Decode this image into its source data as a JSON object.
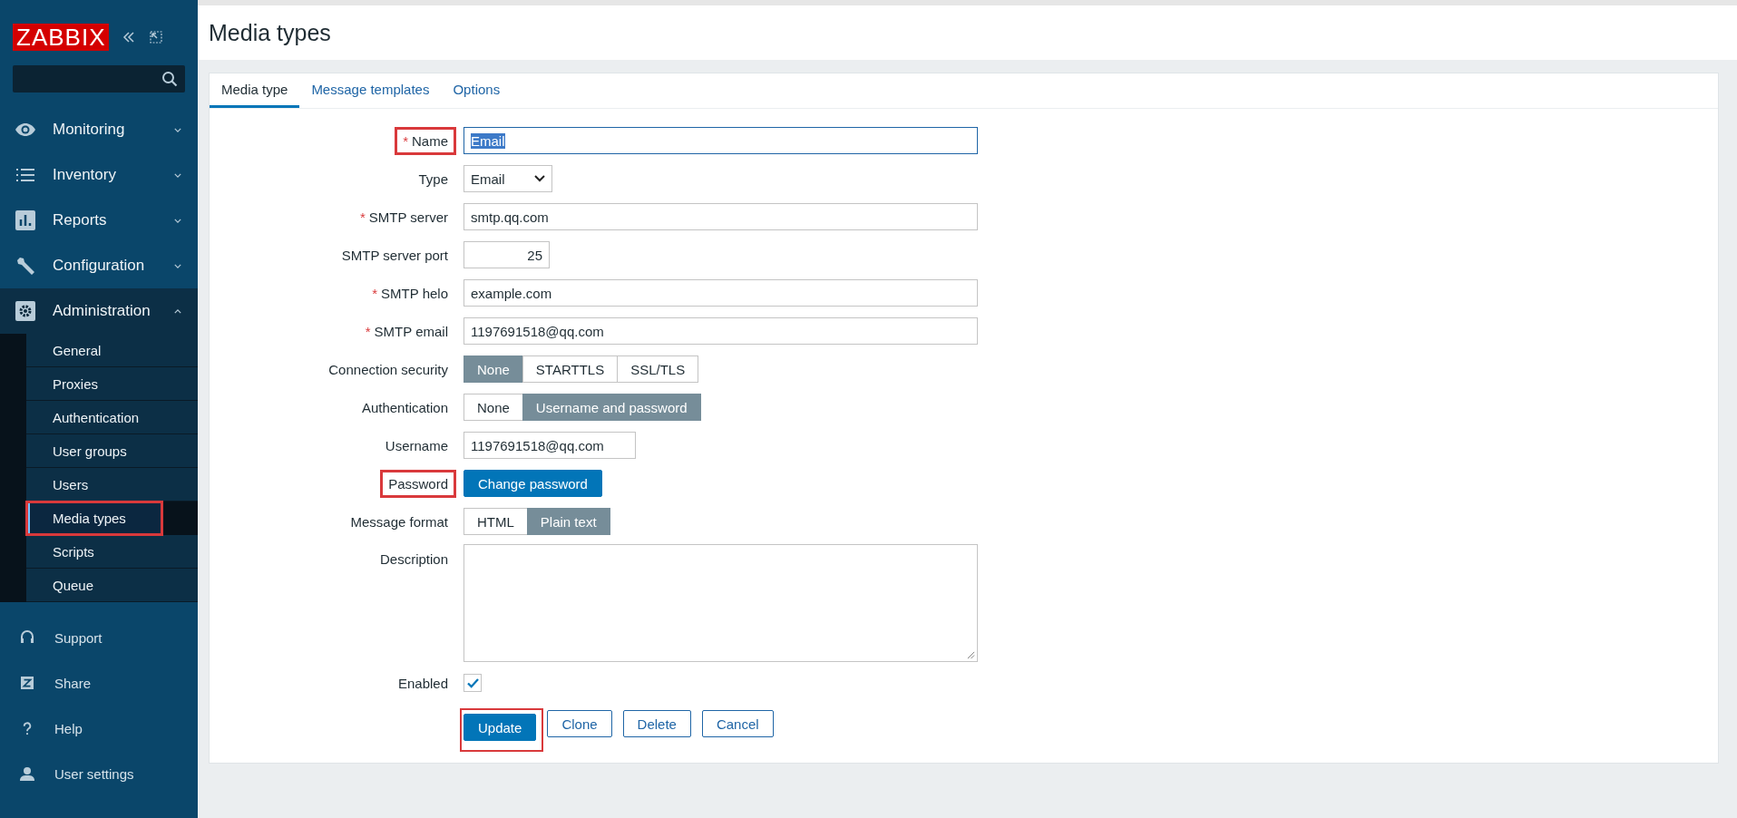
{
  "sidebar": {
    "logo": "ZABBIX",
    "menu": [
      {
        "label": "Monitoring",
        "expanded": false
      },
      {
        "label": "Inventory",
        "expanded": false
      },
      {
        "label": "Reports",
        "expanded": false
      },
      {
        "label": "Configuration",
        "expanded": false
      },
      {
        "label": "Administration",
        "expanded": true,
        "children": [
          {
            "label": "General",
            "selected": false,
            "highlighted": false
          },
          {
            "label": "Proxies",
            "selected": false,
            "highlighted": false
          },
          {
            "label": "Authentication",
            "selected": false,
            "highlighted": false
          },
          {
            "label": "User groups",
            "selected": false,
            "highlighted": false
          },
          {
            "label": "Users",
            "selected": false,
            "highlighted": false
          },
          {
            "label": "Media types",
            "selected": true,
            "highlighted": true
          },
          {
            "label": "Scripts",
            "selected": false,
            "highlighted": false
          },
          {
            "label": "Queue",
            "selected": false,
            "highlighted": false
          }
        ]
      }
    ],
    "footer": [
      {
        "label": "Support"
      },
      {
        "label": "Share"
      },
      {
        "label": "Help"
      },
      {
        "label": "User settings"
      }
    ]
  },
  "page_title": "Media types",
  "tabs": [
    {
      "label": "Media type",
      "selected": true
    },
    {
      "label": "Message templates",
      "selected": false
    },
    {
      "label": "Options",
      "selected": false
    }
  ],
  "form": {
    "fields": [
      {
        "kind": "text",
        "label": "Name",
        "required_mark": "*",
        "highlighted": true,
        "value": "Email",
        "focused": true,
        "text_selected": true
      },
      {
        "kind": "select",
        "label": "Type",
        "highlighted": false,
        "value": "Email"
      },
      {
        "kind": "text",
        "label": "SMTP server",
        "required_mark": "*",
        "highlighted": false,
        "value": "smtp.qq.com",
        "focused": false,
        "text_selected": false
      },
      {
        "kind": "number",
        "label": "SMTP server port",
        "highlighted": false,
        "value": "25"
      },
      {
        "kind": "text",
        "label": "SMTP helo",
        "required_mark": "*",
        "highlighted": false,
        "value": "example.com",
        "focused": false,
        "text_selected": false
      },
      {
        "kind": "text",
        "label": "SMTP email",
        "required_mark": "*",
        "highlighted": false,
        "value": "1197691518@qq.com",
        "focused": false,
        "text_selected": false
      },
      {
        "kind": "segmented",
        "label": "Connection security",
        "highlighted": false,
        "options": [
          {
            "label": "None",
            "selected": true
          },
          {
            "label": "STARTTLS",
            "selected": false
          },
          {
            "label": "SSL/TLS",
            "selected": false
          }
        ]
      },
      {
        "kind": "segmented",
        "label": "Authentication",
        "highlighted": false,
        "options": [
          {
            "label": "None",
            "selected": false
          },
          {
            "label": "Username and password",
            "selected": true
          }
        ]
      },
      {
        "kind": "shorttext",
        "label": "Username",
        "highlighted": false,
        "value": "1197691518@qq.com"
      },
      {
        "kind": "button",
        "label": "Password",
        "highlighted": true,
        "button": "Change password"
      },
      {
        "kind": "segmented",
        "label": "Message format",
        "highlighted": false,
        "options": [
          {
            "label": "HTML",
            "selected": false
          },
          {
            "label": "Plain text",
            "selected": true
          }
        ]
      },
      {
        "kind": "textarea",
        "label": "Description",
        "highlighted": false
      },
      {
        "kind": "checkbox",
        "label": "Enabled",
        "highlighted": false,
        "checked": true
      }
    ],
    "buttons": [
      {
        "label": "Update",
        "kind": "primary",
        "highlighted": true
      },
      {
        "label": "Clone",
        "kind": "secondary",
        "highlighted": false
      },
      {
        "label": "Delete",
        "kind": "secondary",
        "highlighted": false
      },
      {
        "label": "Cancel",
        "kind": "secondary",
        "highlighted": false
      }
    ]
  }
}
